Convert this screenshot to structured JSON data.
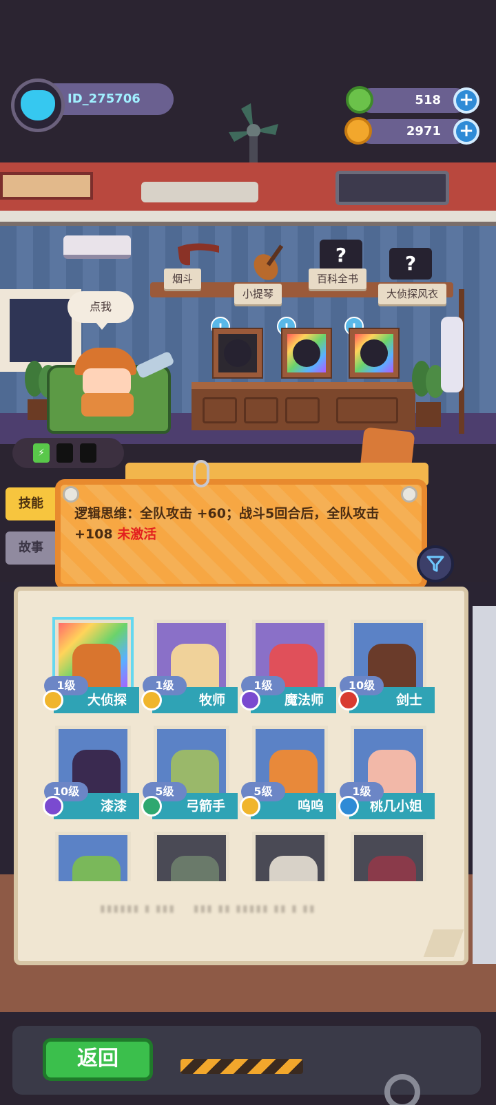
{
  "player": {
    "id": "ID_275706",
    "avatar_icon": "cat-avatar-icon"
  },
  "currencies": [
    {
      "name": "green-gem",
      "value": "518",
      "color": "#6bc24a"
    },
    {
      "name": "gold-planet",
      "value": "2971",
      "color": "#f2a72c"
    }
  ],
  "room": {
    "speech_bubble": "点我",
    "items": [
      {
        "label": "烟斗",
        "icon": "pipe-icon"
      },
      {
        "label": "小提琴",
        "icon": "violin-icon"
      },
      {
        "label": "百科全书",
        "icon": "question-icon"
      },
      {
        "label": "大侦探风衣",
        "icon": "question-icon"
      }
    ],
    "item_symbol": "?",
    "alert_symbol": "!"
  },
  "tabs": {
    "skill": "技能",
    "story": "故事"
  },
  "skill": {
    "description": "逻辑思维：全队攻击 +60；战斗5回合后，全队攻击 +108",
    "status": "未激活"
  },
  "heroes": [
    {
      "level": "1级",
      "name": "大侦探",
      "badge": "gold",
      "selected": true
    },
    {
      "level": "1级",
      "name": "牧师",
      "badge": "gold"
    },
    {
      "level": "1级",
      "name": "魔法师",
      "badge": "purple"
    },
    {
      "level": "10级",
      "name": "剑士",
      "badge": "red"
    },
    {
      "level": "10级",
      "name": "漆漆",
      "badge": "purple"
    },
    {
      "level": "5级",
      "name": "弓箭手",
      "badge": "green"
    },
    {
      "level": "5级",
      "name": "呜呜",
      "badge": "gold"
    },
    {
      "level": "1级",
      "name": "桃几小姐",
      "badge": "blue"
    }
  ],
  "bottom": {
    "back_label": "返回"
  }
}
